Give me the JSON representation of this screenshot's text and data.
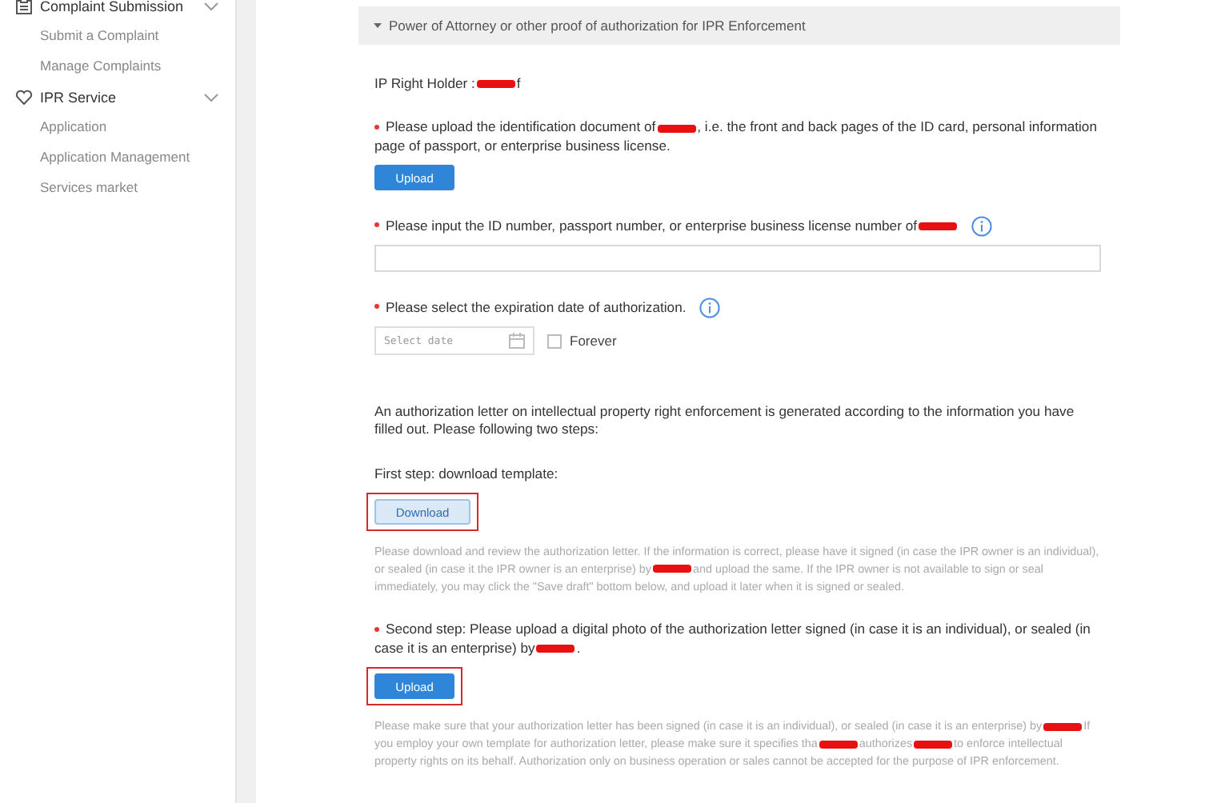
{
  "sidebar": {
    "groups": [
      {
        "title": "Complaint Submission",
        "expanded": true,
        "items": [
          "Submit a Complaint",
          "Manage Complaints"
        ]
      },
      {
        "title": "IPR Service",
        "expanded": true,
        "items": [
          "Application",
          "Application Management",
          "Services market"
        ]
      }
    ]
  },
  "section": {
    "title": "Power of Attorney or other proof of authorization for IPR Enforcement",
    "expanded": true
  },
  "blocks": [
    {
      "kind": "label",
      "parts": [
        {
          "kind": "text",
          "text": "IP Right Holder :"
        },
        {
          "kind": "redacted"
        },
        {
          "kind": "text",
          "text": "f"
        }
      ]
    },
    {
      "kind": "label",
      "required": true,
      "parts": [
        {
          "kind": "text",
          "text": "Please upload the identification document of"
        },
        {
          "kind": "redacted"
        },
        {
          "kind": "text",
          "text": ", i.e. the front and back pages of the ID card, personal information page of passport, or enterprise business license."
        }
      ]
    },
    {
      "kind": "upload",
      "label": "Upload",
      "highlighted": false
    },
    {
      "kind": "label",
      "required": true,
      "info": true,
      "parts": [
        {
          "kind": "text",
          "text": "Please input the ID number, passport number, or enterprise business license number of"
        },
        {
          "kind": "redacted"
        }
      ]
    },
    {
      "kind": "input"
    },
    {
      "kind": "label",
      "required": true,
      "info": true,
      "parts": [
        {
          "kind": "text",
          "text": "Please select the expiration date of authorization."
        }
      ]
    },
    {
      "kind": "date",
      "placeholder": "Select date",
      "checkbox": {
        "label": "Forever",
        "checked": false
      }
    },
    {
      "kind": "label",
      "parts": [
        {
          "kind": "text",
          "text": "An authorization letter on intellectual property right enforcement is generated according to the information you have filled out. Please following two steps:"
        }
      ]
    },
    {
      "kind": "label",
      "parts": [
        {
          "kind": "text",
          "text": "First step: download template:"
        }
      ]
    },
    {
      "kind": "download",
      "label": "Download",
      "highlighted": true
    },
    {
      "kind": "hint",
      "parts": [
        {
          "kind": "text",
          "text": "Please download and review the authorization letter. If the information is correct, please have it signed (in case the IPR owner is an individual), or sealed (in case it the IPR owner is an enterprise) by"
        },
        {
          "kind": "redacted"
        },
        {
          "kind": "text",
          "text": "and upload the same. If the IPR owner is not available to sign or seal immediately, you may click the \"Save draft\" bottom below, and upload it later when it is signed or sealed."
        }
      ]
    },
    {
      "kind": "label",
      "required": true,
      "parts": [
        {
          "kind": "text",
          "text": "Second step: Please upload a digital photo of the authorization letter signed (in case it is an individual), or sealed (in case it is an enterprise) by"
        },
        {
          "kind": "redacted"
        },
        {
          "kind": "text",
          "text": "."
        }
      ]
    },
    {
      "kind": "upload",
      "label": "Upload",
      "highlighted": true
    },
    {
      "kind": "hint",
      "parts": [
        {
          "kind": "text",
          "text": "Please make sure that your authorization letter has been signed (in case it is an individual), or sealed (in case it is an enterprise) by"
        },
        {
          "kind": "redacted"
        },
        {
          "kind": "text",
          "text": "If you employ your own template for authorization letter, please make sure it specifies tha"
        },
        {
          "kind": "redacted"
        },
        {
          "kind": "text",
          "text": "authorizes"
        },
        {
          "kind": "redacted"
        },
        {
          "kind": "text",
          "text": "to enforce intellectual property rights on its behalf. Authorization only on business operation or sales cannot be accepted for the purpose of IPR enforcement."
        }
      ]
    }
  ]
}
